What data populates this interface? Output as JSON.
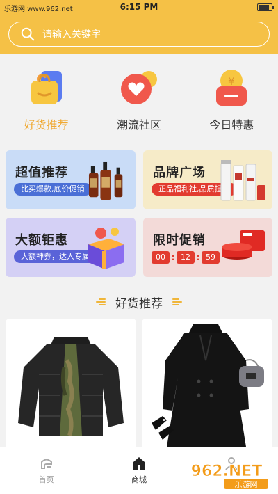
{
  "status_bar": {
    "carrier": "乐游网 www.962.net",
    "time": "6:15 PM",
    "battery_level": 0.85
  },
  "search": {
    "placeholder": "请输入关键字",
    "icon": "search-icon"
  },
  "categories": [
    {
      "label": "好货推荐",
      "icon": "shopping-bag-icon",
      "active": true
    },
    {
      "label": "潮流社区",
      "icon": "heart-bubble-icon",
      "active": false
    },
    {
      "label": "今日特惠",
      "icon": "coin-pouch-icon",
      "active": false
    }
  ],
  "promos": [
    {
      "title": "超值推荐",
      "subtitle": "比买爆款,底价促销"
    },
    {
      "title": "品牌广场",
      "subtitle": "正品福利社,品质担当"
    },
    {
      "title": "大额钜惠",
      "subtitle": "大额神券，达人专属"
    },
    {
      "title": "限时促销",
      "timer": [
        "00",
        "12",
        "59"
      ]
    }
  ],
  "section": {
    "title": "好货推荐"
  },
  "bottom_nav": [
    {
      "label": "首页",
      "icon": "home-icon"
    },
    {
      "label": "商城",
      "icon": "store-icon"
    },
    {
      "label": "",
      "icon": "user-icon"
    }
  ],
  "watermark": {
    "brand": "962.NET",
    "sub": "乐游网"
  },
  "colors": {
    "accent": "#f5c146",
    "active_label": "#f0a932",
    "promo_red": "#e23b2f"
  }
}
